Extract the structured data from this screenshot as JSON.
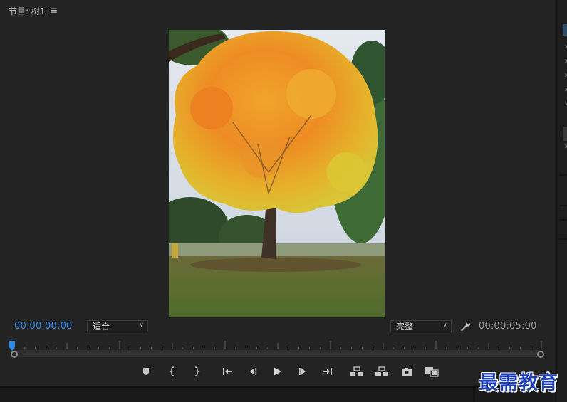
{
  "panel": {
    "tab_label": "节目: 树1",
    "menu_icon": "hamburger-menu-icon"
  },
  "preview": {
    "subject": "autumn-tree-image"
  },
  "timecodes": {
    "current": "00:00:00:00",
    "duration": "00:00:05:00"
  },
  "zoom": {
    "selected": "适合"
  },
  "quality": {
    "selected": "完整"
  },
  "colors": {
    "accent": "#2d8ceb",
    "panel_bg": "#232323",
    "text": "#b8b8b8"
  },
  "transport": [
    {
      "name": "add-marker-button",
      "icon": "marker-icon"
    },
    {
      "name": "mark-in-button",
      "icon": "mark-in-icon"
    },
    {
      "name": "mark-out-button",
      "icon": "mark-out-icon"
    },
    {
      "name": "go-to-in-button",
      "icon": "go-to-in-icon"
    },
    {
      "name": "step-back-button",
      "icon": "step-back-icon"
    },
    {
      "name": "play-button",
      "icon": "play-icon"
    },
    {
      "name": "step-forward-button",
      "icon": "step-forward-icon"
    },
    {
      "name": "go-to-out-button",
      "icon": "go-to-out-icon"
    },
    {
      "name": "lift-button",
      "icon": "lift-icon"
    },
    {
      "name": "extract-button",
      "icon": "extract-icon"
    },
    {
      "name": "export-frame-button",
      "icon": "camera-icon"
    },
    {
      "name": "comparison-view-button",
      "icon": "compare-icon"
    }
  ],
  "watermark": {
    "text": "最需教育"
  }
}
